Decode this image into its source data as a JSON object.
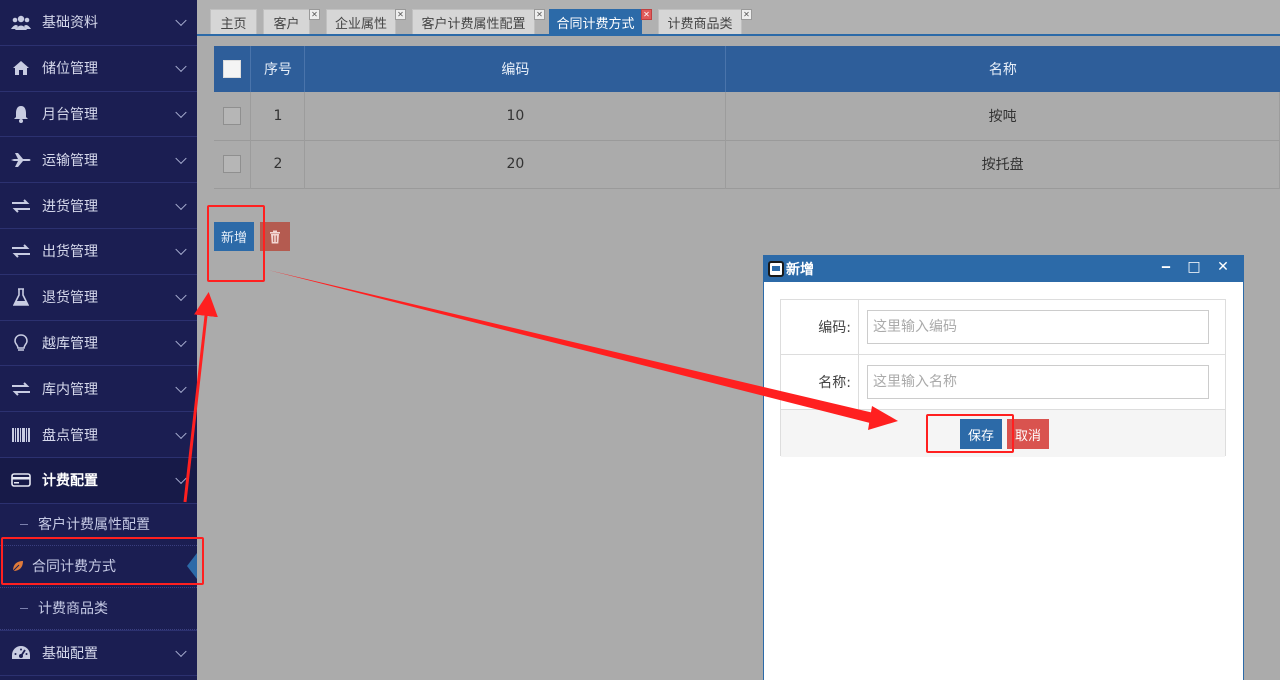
{
  "sidebar": {
    "items": [
      {
        "label": "基础资料",
        "icon": "users-icon"
      },
      {
        "label": "储位管理",
        "icon": "home-icon"
      },
      {
        "label": "月台管理",
        "icon": "bell-icon"
      },
      {
        "label": "运输管理",
        "icon": "plane-icon"
      },
      {
        "label": "进货管理",
        "icon": "exchange-icon"
      },
      {
        "label": "出货管理",
        "icon": "exchange-icon"
      },
      {
        "label": "退货管理",
        "icon": "flask-icon"
      },
      {
        "label": "越库管理",
        "icon": "lightbulb-icon"
      },
      {
        "label": "库内管理",
        "icon": "exchange-icon"
      },
      {
        "label": "盘点管理",
        "icon": "barcode-icon"
      },
      {
        "label": "计费配置",
        "icon": "credit-card-icon"
      }
    ],
    "submenu": [
      {
        "label": "客户计费属性配置"
      },
      {
        "label": "合同计费方式"
      },
      {
        "label": "计费商品类"
      }
    ],
    "last_item": {
      "label": "基础配置",
      "icon": "dashboard-icon"
    }
  },
  "tabs": [
    {
      "label": "主页"
    },
    {
      "label": "客户"
    },
    {
      "label": "企业属性"
    },
    {
      "label": "客户计费属性配置"
    },
    {
      "label": "合同计费方式"
    },
    {
      "label": "计费商品类"
    }
  ],
  "table": {
    "headers": [
      "序号",
      "编码",
      "名称"
    ],
    "rows": [
      {
        "index": "1",
        "code": "10",
        "name": "按吨"
      },
      {
        "index": "2",
        "code": "20",
        "name": "按托盘"
      }
    ]
  },
  "toolbar": {
    "add_label": "新增"
  },
  "dialog": {
    "title": "新增",
    "code_label": "编码:",
    "code_placeholder": "这里输入编码",
    "name_label": "名称:",
    "name_placeholder": "这里输入名称",
    "save_label": "保存",
    "cancel_label": "取消"
  },
  "colors": {
    "sidebar_bg": "#1b1e52",
    "accent": "#2c6aa8",
    "danger": "#d9534f",
    "annotation": "#ff2020"
  }
}
